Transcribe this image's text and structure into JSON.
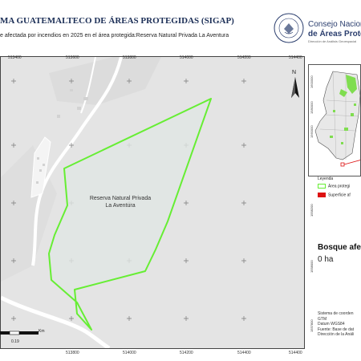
{
  "header": {
    "title": "MA GUATEMALTECO DE ÁREAS PROTEGIDAS  (SIGAP)",
    "subtitle": "e afectada por incendios en 2025 en el área protegida:Reserva Natural Privada La Aventura",
    "seal_text": "GUATEMALA",
    "cn_line1": "Consejo Nacional",
    "cn_line2": "de Áreas Protegid",
    "cn_line3": "Dirección de Análisis Geoespacial"
  },
  "map": {
    "x_ticks": [
      "513400",
      "513600",
      "513800",
      "514000",
      "514200",
      "514400"
    ],
    "protected_area_label": "Reserva Natural Privada La Aventura",
    "north_label": "N",
    "scale_unit": "Km",
    "scale_value": "0.19",
    "colors": {
      "boundary": "#66ee33",
      "area_fill": "#e0e6e4",
      "background": "#e4e4e4",
      "road": "#ffffff"
    }
  },
  "inset": {
    "y_ticks": [
      "1560000",
      "1580000",
      "1600000",
      "1620000"
    ],
    "colors": {
      "country": "#e8e8e8",
      "protected": "#7fdd4f"
    }
  },
  "legend": {
    "title": "Leyenda",
    "items": [
      {
        "label": "Área protegi",
        "color": "#66ee33"
      },
      {
        "label": "Superficie af",
        "color": "#dd1111"
      }
    ]
  },
  "summary": {
    "heading": "Bosque afe",
    "value": "0 ha"
  },
  "info": {
    "lines": [
      "Sistema de coorden",
      "GTM",
      "Datum WGS84",
      "Fuente: Base de dat",
      "Dirección de la Análi"
    ]
  },
  "side_ticks": [
    "1558200",
    "1558000",
    "1557800"
  ]
}
